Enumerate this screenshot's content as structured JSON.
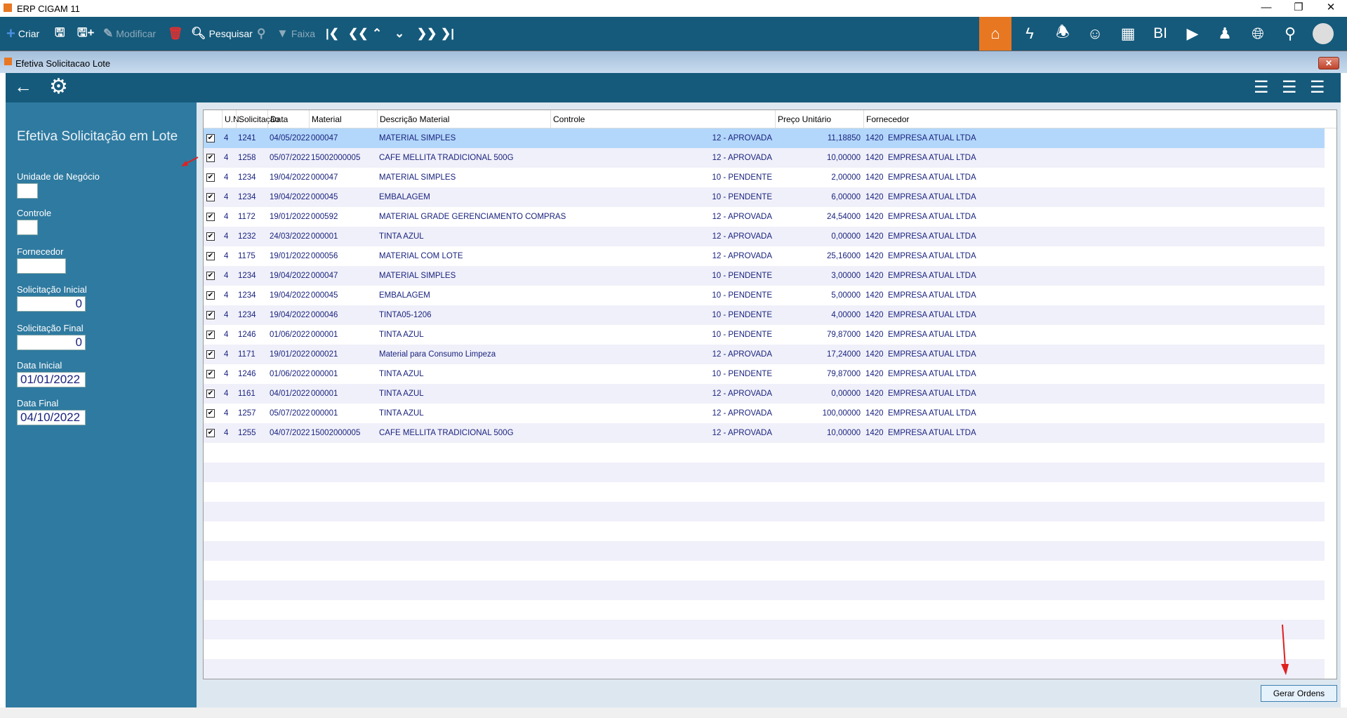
{
  "app": {
    "title": "ERP CIGAM 11",
    "window_controls": [
      "minimize",
      "restore",
      "close"
    ]
  },
  "toolbar": {
    "criar": "Criar",
    "modificar": "Modificar",
    "pesquisar": "Pesquisar",
    "faixa": "Faixa",
    "right_icons": [
      "cigam-home-icon",
      "lightning-icon",
      "bell-icon",
      "support-icon",
      "grid-icon",
      "BI",
      "play-chat-icon",
      "user-chat-icon",
      "globe-icon",
      "search-icon",
      "avatar"
    ],
    "bi_label": "BI"
  },
  "window": {
    "title": "Efetiva Solicitacao Lote"
  },
  "filters": {
    "title": "Efetiva Solicitação em Lote",
    "unidade_label": "Unidade de Negócio",
    "unidade_value": "",
    "controle_label": "Controle",
    "controle_value": "",
    "fornecedor_label": "Fornecedor",
    "fornecedor_value": "",
    "sol_ini_label": "Solicitação Inicial",
    "sol_ini_value": "0",
    "sol_fim_label": "Solicitação Final",
    "sol_fim_value": "0",
    "data_ini_label": "Data Inicial",
    "data_ini_value": "01/01/2022",
    "data_fim_label": "Data Final",
    "data_fim_value": "04/10/2022"
  },
  "grid": {
    "columns": [
      "U.N.",
      "Solicitação",
      "Data",
      "Material",
      "Descrição Material",
      "Controle",
      "Preço Unitário",
      "Fornecedor"
    ],
    "rows": [
      {
        "checked": true,
        "un": "4",
        "sol": "1241",
        "data": "04/05/2022",
        "mat": "000047",
        "desc": "MATERIAL SIMPLES",
        "ctrl": "12 - APROVADA",
        "preco": "11,18850",
        "forn": "1420  EMPRESA ATUAL LTDA",
        "selected": true
      },
      {
        "checked": true,
        "un": "4",
        "sol": "1258",
        "data": "05/07/2022",
        "mat": "15002000005",
        "desc": "CAFE MELLITA TRADICIONAL 500G",
        "ctrl": "12 - APROVADA",
        "preco": "10,00000",
        "forn": "1420  EMPRESA ATUAL LTDA"
      },
      {
        "checked": true,
        "un": "4",
        "sol": "1234",
        "data": "19/04/2022",
        "mat": "000047",
        "desc": "MATERIAL SIMPLES",
        "ctrl": "10 - PENDENTE",
        "preco": "2,00000",
        "forn": "1420  EMPRESA ATUAL LTDA"
      },
      {
        "checked": true,
        "un": "4",
        "sol": "1234",
        "data": "19/04/2022",
        "mat": "000045",
        "desc": "EMBALAGEM",
        "ctrl": "10 - PENDENTE",
        "preco": "6,00000",
        "forn": "1420  EMPRESA ATUAL LTDA"
      },
      {
        "checked": true,
        "un": "4",
        "sol": "1172",
        "data": "19/01/2022",
        "mat": "000592",
        "desc": "MATERIAL GRADE GERENCIAMENTO COMPRAS",
        "ctrl": "12 - APROVADA",
        "preco": "24,54000",
        "forn": "1420  EMPRESA ATUAL LTDA"
      },
      {
        "checked": true,
        "un": "4",
        "sol": "1232",
        "data": "24/03/2022",
        "mat": "000001",
        "desc": "TINTA AZUL",
        "ctrl": "12 - APROVADA",
        "preco": "0,00000",
        "forn": "1420  EMPRESA ATUAL LTDA"
      },
      {
        "checked": true,
        "un": "4",
        "sol": "1175",
        "data": "19/01/2022",
        "mat": "000056",
        "desc": "MATERIAL  COM LOTE",
        "ctrl": "12 - APROVADA",
        "preco": "25,16000",
        "forn": "1420  EMPRESA ATUAL LTDA"
      },
      {
        "checked": true,
        "un": "4",
        "sol": "1234",
        "data": "19/04/2022",
        "mat": "000047",
        "desc": "MATERIAL SIMPLES",
        "ctrl": "10 - PENDENTE",
        "preco": "3,00000",
        "forn": "1420  EMPRESA ATUAL LTDA"
      },
      {
        "checked": true,
        "un": "4",
        "sol": "1234",
        "data": "19/04/2022",
        "mat": "000045",
        "desc": "EMBALAGEM",
        "ctrl": "10 - PENDENTE",
        "preco": "5,00000",
        "forn": "1420  EMPRESA ATUAL LTDA"
      },
      {
        "checked": true,
        "un": "4",
        "sol": "1234",
        "data": "19/04/2022",
        "mat": "000046",
        "desc": "TINTA05-1206",
        "ctrl": "10 - PENDENTE",
        "preco": "4,00000",
        "forn": "1420  EMPRESA ATUAL LTDA"
      },
      {
        "checked": true,
        "un": "4",
        "sol": "1246",
        "data": "01/06/2022",
        "mat": "000001",
        "desc": "TINTA AZUL",
        "ctrl": "10 - PENDENTE",
        "preco": "79,87000",
        "forn": "1420  EMPRESA ATUAL LTDA"
      },
      {
        "checked": true,
        "un": "4",
        "sol": "1171",
        "data": "19/01/2022",
        "mat": "000021",
        "desc": "Material para Consumo Limpeza",
        "ctrl": "12 - APROVADA",
        "preco": "17,24000",
        "forn": "1420  EMPRESA ATUAL LTDA"
      },
      {
        "checked": true,
        "un": "4",
        "sol": "1246",
        "data": "01/06/2022",
        "mat": "000001",
        "desc": "TINTA AZUL",
        "ctrl": "10 - PENDENTE",
        "preco": "79,87000",
        "forn": "1420  EMPRESA ATUAL LTDA"
      },
      {
        "checked": true,
        "un": "4",
        "sol": "1161",
        "data": "04/01/2022",
        "mat": "000001",
        "desc": "TINTA AZUL",
        "ctrl": "12 - APROVADA",
        "preco": "0,00000",
        "forn": "1420  EMPRESA ATUAL LTDA"
      },
      {
        "checked": true,
        "un": "4",
        "sol": "1257",
        "data": "05/07/2022",
        "mat": "000001",
        "desc": "TINTA AZUL",
        "ctrl": "12 - APROVADA",
        "preco": "100,00000",
        "forn": "1420  EMPRESA ATUAL LTDA"
      },
      {
        "checked": true,
        "un": "4",
        "sol": "1255",
        "data": "04/07/2022",
        "mat": "15002000005",
        "desc": "CAFE MELLITA TRADICIONAL 500G",
        "ctrl": "12 - APROVADA",
        "preco": "10,00000",
        "forn": "1420  EMPRESA ATUAL LTDA"
      }
    ]
  },
  "actions": {
    "gerar_ordens": "Gerar Ordens"
  },
  "colors": {
    "toolbar": "#155a7b",
    "panel": "#2f7aa0",
    "accent": "#e87722",
    "selected_row": "#b3d7fb",
    "alt_row": "#f0f0fa",
    "text": "#1a237e",
    "annotation_arrow": "#e02020"
  }
}
